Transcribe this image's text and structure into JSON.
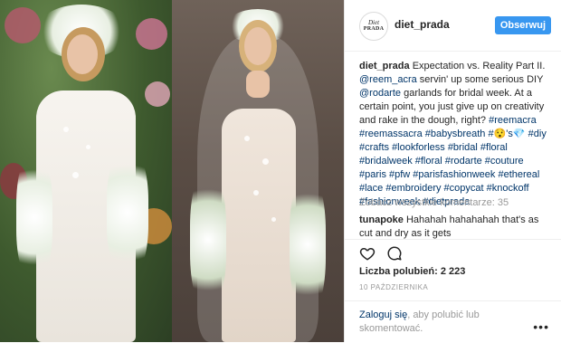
{
  "post": {
    "username": "diet_prada",
    "follow_label": "Obserwuj",
    "avatar_line1": "Diet",
    "avatar_line2": "PRADA",
    "caption": {
      "user": "diet_prada",
      "p1": " Expectation vs. Reality Part II. ",
      "m1": "@reem_acra",
      "p2": " servin' up some serious DIY ",
      "m2": "@rodarte",
      "p3": " garlands for bridal week. At a certain point, you just give up on creativity and rake in the dough, right? ",
      "tags1": "#reemacra #reemassacra #babysbreath #",
      "emoji1": "😯",
      "p4": "'s",
      "emoji2": "💎",
      "tags2": " #diy #crafts #lookforless #bridal #floral #bridalweek #floral #rodarte #couture #paris #pfw #parisfashionweek #ethereal #lace #embroidery #copycat #knockoff #fashionweek #dietprada"
    },
    "view_all_comments": "Zobacz wszystkie komentarze: 35",
    "comment": {
      "user": "tunapoke",
      "text": " Hahahah hahahahah that's as cut and dry as it gets"
    },
    "likes_label": "Liczba polubień: 2 223",
    "date": "10 PAŹDZIERNIKA",
    "login_link": "Zaloguj się",
    "login_rest": ", aby polubić lub skomentować.",
    "more_glyph": "•••"
  },
  "icons": [
    "heart-icon",
    "comment-icon",
    "more-options-icon"
  ]
}
